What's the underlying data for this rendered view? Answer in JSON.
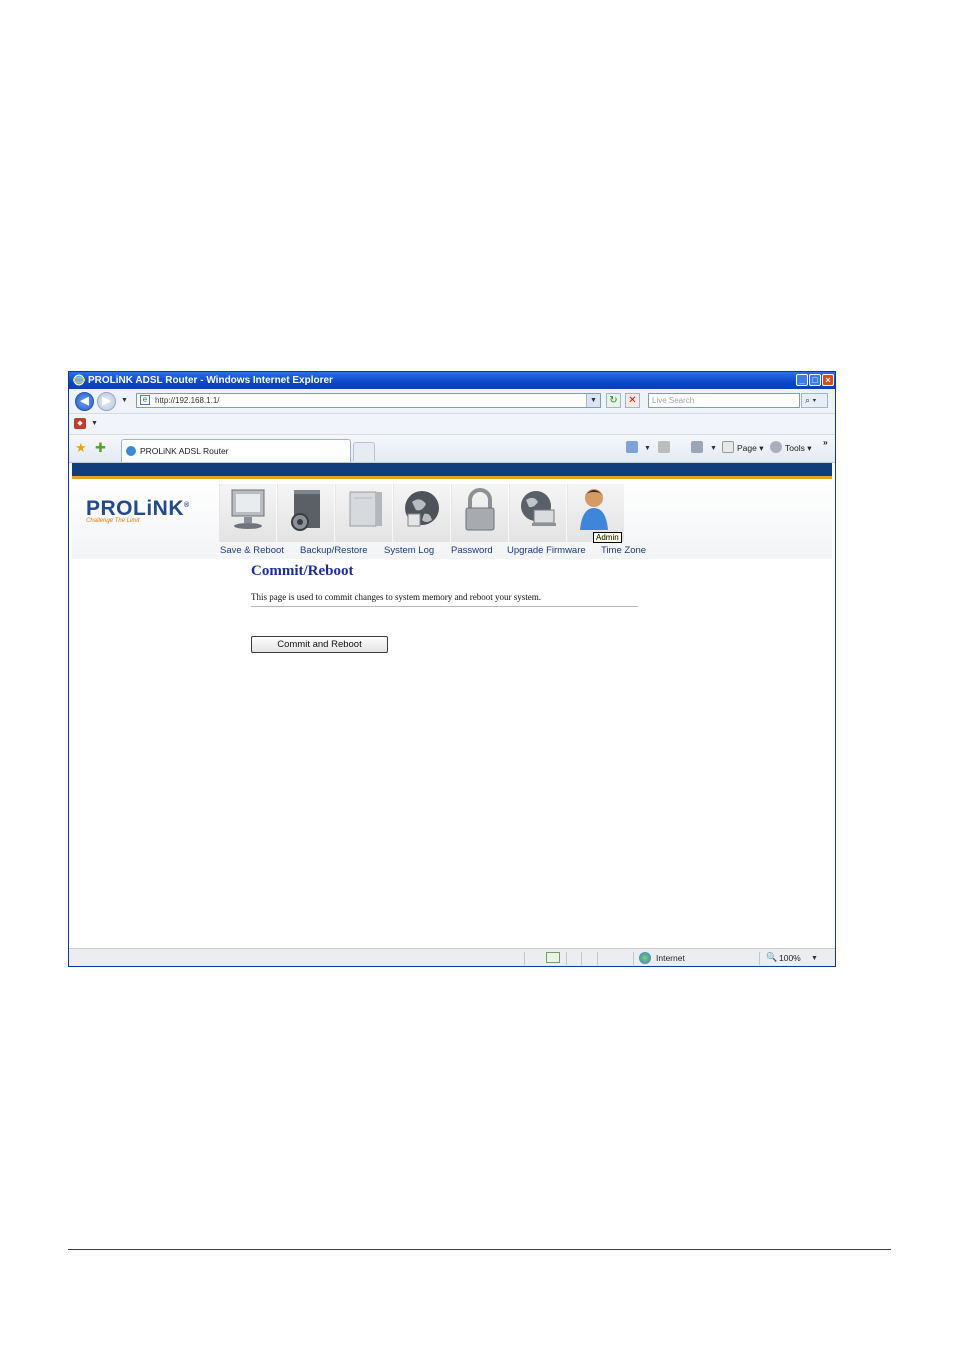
{
  "window": {
    "title": "PROLiNK ADSL Router - Windows Internet Explorer",
    "controls": {
      "minimize": "_",
      "maximize": "□",
      "close": "×"
    }
  },
  "address_bar": {
    "url": "http://192.168.1.1/",
    "search_placeholder": "Live Search"
  },
  "tab": {
    "label": "PROLiNK ADSL Router"
  },
  "command_bar": {
    "page_label": "Page",
    "tools_label": "Tools",
    "more": "»"
  },
  "router": {
    "logo": {
      "brand": "PROLiNK",
      "tagline": "Challenge The Limit"
    },
    "nav": [
      {
        "label": "Save & Reboot",
        "icon": "monitor-icon"
      },
      {
        "label": "Backup/Restore",
        "icon": "backup-gear-icon"
      },
      {
        "label": "System Log",
        "icon": "server-icon"
      },
      {
        "label": "Password",
        "icon": "globe-icon"
      },
      {
        "label": "Upgrade Firmware",
        "icon": "padlock-icon"
      },
      {
        "label": "Time Zone",
        "icon": "globe-laptop-icon"
      }
    ],
    "tooltip": "Admin",
    "page_title": "Commit/Reboot",
    "page_description": "This page is used to commit changes to system memory and reboot your system.",
    "commit_button": "Commit and Reboot"
  },
  "status_bar": {
    "zone": "Internet",
    "zoom": "100%"
  },
  "colors": {
    "titlebar": "#0a47c8",
    "router_stripe": "#123d7d",
    "router_accent": "#e6a21a",
    "page_title": "#1b2d9d"
  }
}
